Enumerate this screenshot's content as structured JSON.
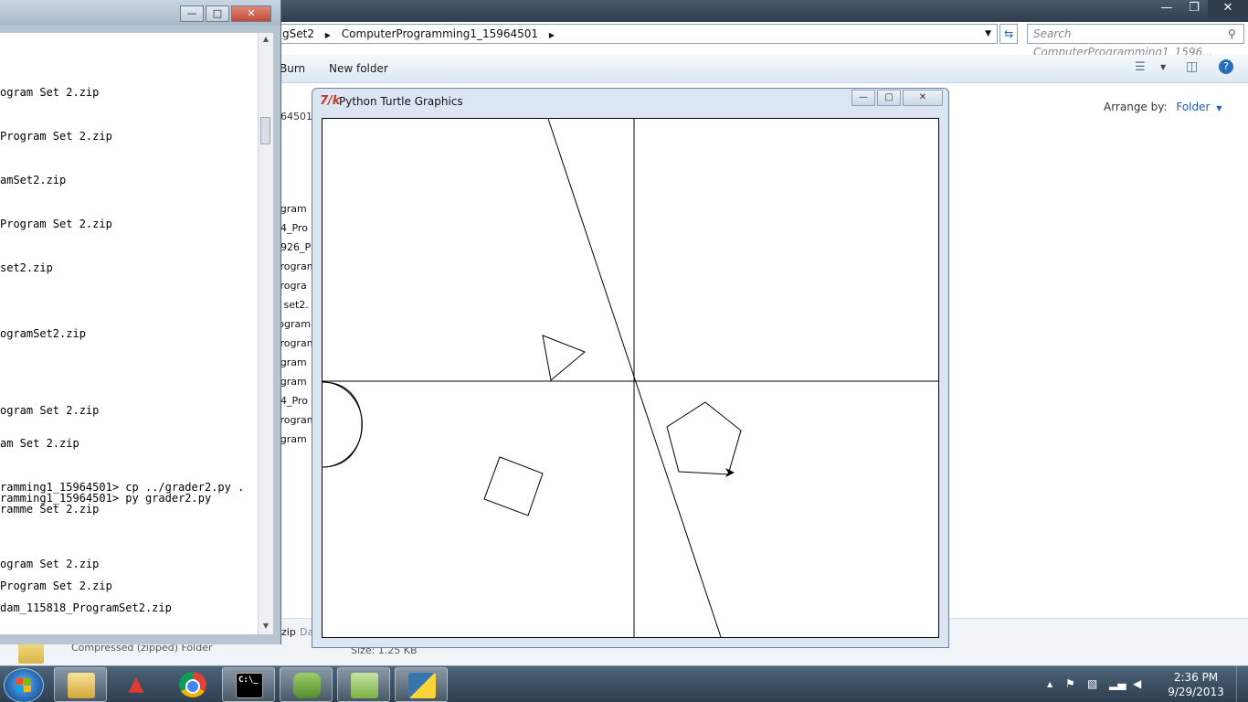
{
  "explorer": {
    "address": {
      "part1": "gSet2",
      "part2": "ComputerProgramming1_15964501"
    },
    "search_placeholder": "Search ComputerProgramming1_1596...",
    "toolbar": {
      "burn": "Burn",
      "new_folder": "New folder"
    },
    "arrange_label": "Arrange by:",
    "arrange_value": "Folder",
    "breadcrumb_fragment": "964501",
    "file_fragments": [
      "ogram",
      "04_Pro",
      "5926_P",
      "Program",
      "Progra",
      "n set2.",
      "rogram",
      "Program",
      "ogram",
      "ogram",
      "04_Pro",
      "Program",
      "ogram"
    ],
    "bottom_fragment": "zip",
    "bottom_fragment2": "Da",
    "details": {
      "type": "Compressed (zipped) Folder",
      "size": "Size: 1.25 KB"
    }
  },
  "console": {
    "lines": [
      {
        "text": "ogram Set 2.zip",
        "row": 0
      },
      {
        "text": "Program Set 2.zip",
        "row": 1
      },
      {
        "text": "amSet2.zip",
        "row": 2
      },
      {
        "text": "Program Set 2.zip",
        "row": 3
      },
      {
        "text": "set2.zip",
        "row": 4
      },
      {
        "text": "ogramSet2.zip",
        "row": 5
      },
      {
        "text": "ogram Set 2.zip",
        "row": 6
      },
      {
        "text": "am Set 2.zip",
        "row": 7
      },
      {
        "text": "ramming1_15964501> cp ../grader2.py .",
        "row": 8
      },
      {
        "text": "ramming1_15964501> py grader2.py",
        "row": 9
      },
      {
        "text": "ramme Set 2.zip",
        "row": 10
      },
      {
        "text": "ogram Set 2.zip",
        "row": 11
      },
      {
        "text": "Program Set 2.zip",
        "row": 12
      },
      {
        "text": "dam_115818_ProgramSet2.zip",
        "row": 13
      }
    ]
  },
  "turtle_window": {
    "title": "Python Turtle Graphics",
    "icon_glyph": "7/k"
  },
  "taskbar": {
    "clock_time": "2:36 PM",
    "clock_date": "9/29/2013",
    "items": [
      {
        "name": "windows-explorer",
        "label": ""
      },
      {
        "name": "autocad-lt",
        "label": "LT"
      },
      {
        "name": "chrome",
        "label": ""
      },
      {
        "name": "command-prompt",
        "label": "C:\\_"
      },
      {
        "name": "python-idle",
        "label": ""
      },
      {
        "name": "notepad-plus",
        "label": ""
      },
      {
        "name": "python",
        "label": ""
      }
    ]
  }
}
